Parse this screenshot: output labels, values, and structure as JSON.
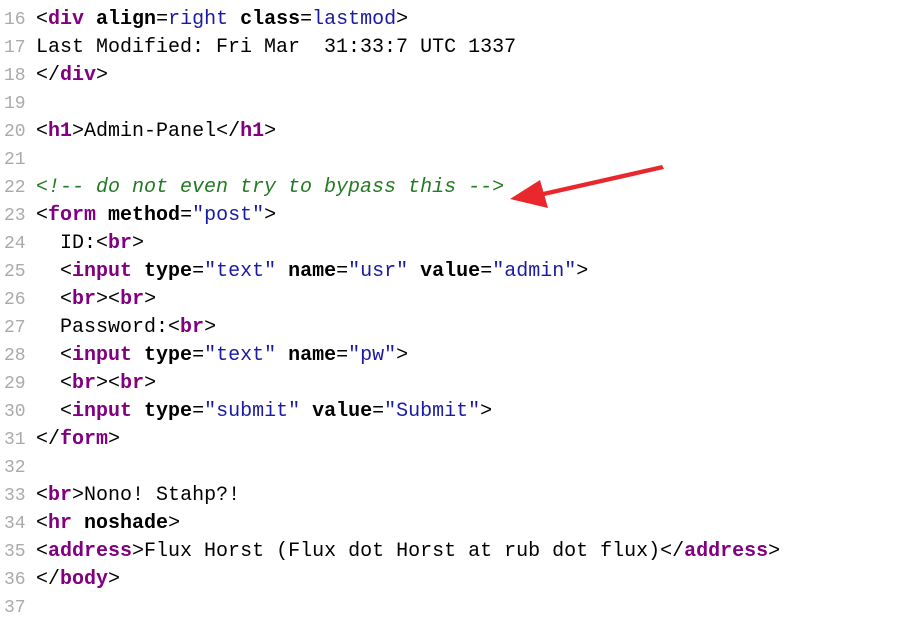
{
  "code_lines": [
    {
      "number": "16",
      "lt": "<",
      "tag": "div",
      "sp1": " ",
      "attr1": "align",
      "eq1": "=",
      "val1": "right",
      "sp2": " ",
      "attr2": "class",
      "eq2": "=",
      "val2": "lastmod",
      "gt": ">"
    },
    {
      "number": "17",
      "text": "Last Modified: Fri Mar  31:33:7 UTC 1337"
    },
    {
      "number": "18",
      "lt": "</",
      "tag": "div",
      "gt": ">"
    },
    {
      "number": "19"
    },
    {
      "number": "20",
      "lt": "<",
      "tag": "h1",
      "gt": ">",
      "text": "Admin-Panel",
      "lt2": "</",
      "tag2": "h1",
      "gt2": ">"
    },
    {
      "number": "21"
    },
    {
      "number": "22",
      "comment": "<!-- do not even try to bypass this -->"
    },
    {
      "number": "23",
      "lt": "<",
      "tag": "form",
      "sp1": " ",
      "attr1": "method",
      "eq1": "=",
      "val1": "\"post\"",
      "gt": ">"
    },
    {
      "number": "24",
      "text": "ID:",
      "lt": "<",
      "tag": "br",
      "gt": ">"
    },
    {
      "number": "25",
      "lt": "<",
      "tag": "input",
      "sp1": " ",
      "attr1": "type",
      "eq1": "=",
      "val1": "\"text\"",
      "sp2": " ",
      "attr2": "name",
      "eq2": "=",
      "val2": "\"usr\"",
      "sp3": " ",
      "attr3": "value",
      "eq3": "=",
      "val3": "\"admin\"",
      "gt": ">"
    },
    {
      "number": "26",
      "lt": "<",
      "tag": "br",
      "gt": ">",
      "lt2": "<",
      "tag2": "br",
      "gt2": ">"
    },
    {
      "number": "27",
      "text": "Password:",
      "lt": "<",
      "tag": "br",
      "gt": ">"
    },
    {
      "number": "28",
      "lt": "<",
      "tag": "input",
      "sp1": " ",
      "attr1": "type",
      "eq1": "=",
      "val1": "\"text\"",
      "sp2": " ",
      "attr2": "name",
      "eq2": "=",
      "val2": "\"pw\"",
      "gt": ">"
    },
    {
      "number": "29",
      "lt": "<",
      "tag": "br",
      "gt": ">",
      "lt2": "<",
      "tag2": "br",
      "gt2": ">"
    },
    {
      "number": "30",
      "lt": "<",
      "tag": "input",
      "sp1": " ",
      "attr1": "type",
      "eq1": "=",
      "val1": "\"submit\"",
      "sp2": " ",
      "attr2": "value",
      "eq2": "=",
      "val2": "\"Submit\"",
      "gt": ">"
    },
    {
      "number": "31",
      "lt": "</",
      "tag": "form",
      "gt": ">"
    },
    {
      "number": "32"
    },
    {
      "number": "33",
      "lt": "<",
      "tag": "br",
      "gt": ">",
      "text": "Nono! Stahp?!"
    },
    {
      "number": "34",
      "lt": "<",
      "tag": "hr",
      "sp1": " ",
      "attr1": "noshade",
      "gt": ">"
    },
    {
      "number": "35",
      "lt": "<",
      "tag": "address",
      "gt": ">",
      "text": "Flux Horst (Flux dot Horst at rub dot flux)",
      "lt2": "</",
      "tag2": "address",
      "gt2": ">"
    },
    {
      "number": "36",
      "lt": "</",
      "tag": "body",
      "gt": ">"
    },
    {
      "number": "37"
    }
  ],
  "annotation": {
    "arrow_color": "#e8282c",
    "icon": "red-pointer-arrow-icon"
  }
}
